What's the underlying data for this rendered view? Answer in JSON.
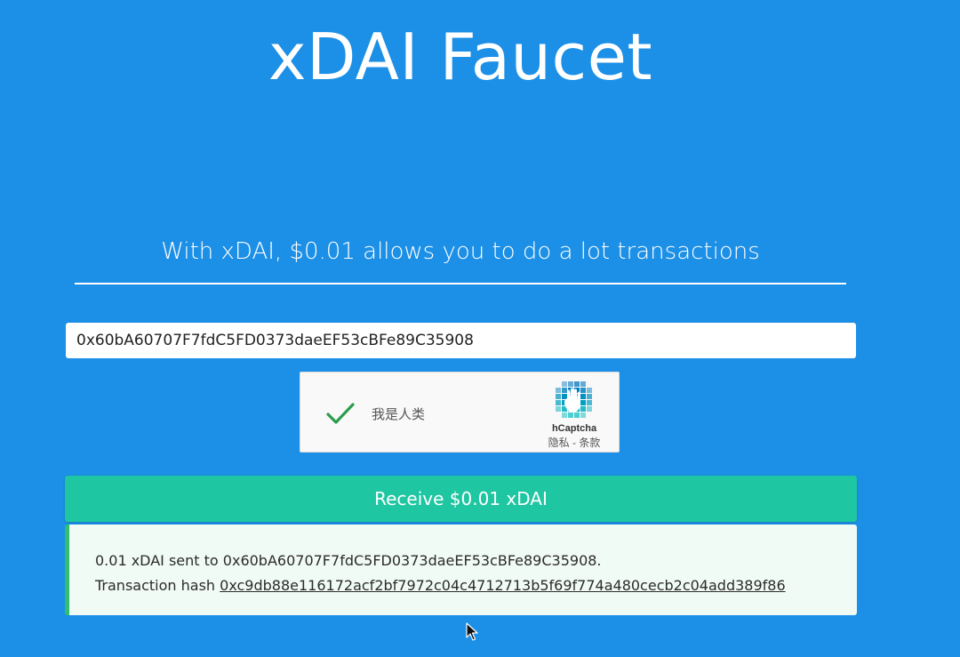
{
  "header": {
    "title": "xDAI Faucet"
  },
  "tagline": "With xDAI, $0.01 allows you to do a lot transactions",
  "form": {
    "address_value": "0x60bA60707F7fdC5FD0373daeEF53cBFe89C35908"
  },
  "captcha": {
    "label": "我是人类",
    "brand": "hCaptcha",
    "privacy": "隐私",
    "separator": " - ",
    "terms": "条款",
    "checked": true
  },
  "receive_button": {
    "label": "Receive $0.01 xDAI"
  },
  "result": {
    "sent_message": "0.01 xDAI sent to 0x60bA60707F7fdC5FD0373daeEF53cBFe89C35908.",
    "hash_label": "Transaction hash",
    "hash_value": "0xc9db88e116172acf2bf7972c04c4712713b5f69f774a480cecb2c04add389f86"
  },
  "colors": {
    "background": "#1c8fe6",
    "button": "#1ec6a1",
    "success_border": "#2fbf6f",
    "success_bg": "#f1fbf5",
    "check": "#2a9d4c"
  }
}
